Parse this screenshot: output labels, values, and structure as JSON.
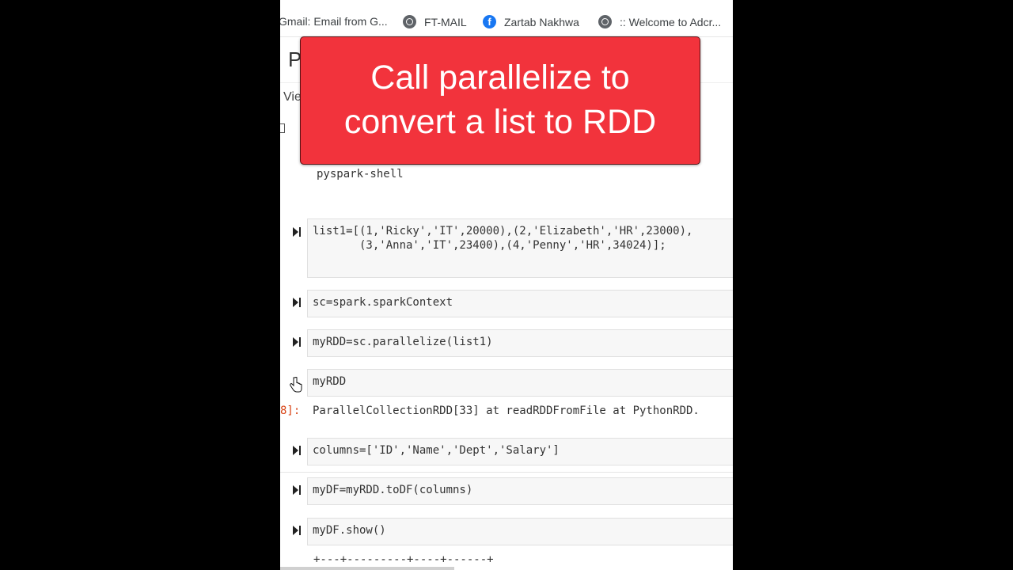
{
  "bookmarks": [
    {
      "label": "Gmail: Email from G...",
      "icon": "gmail-icon"
    },
    {
      "label": "FT-MAIL",
      "icon": "globe-icon"
    },
    {
      "label": "Zartab Nakhwa",
      "icon": "facebook-icon"
    },
    {
      "label": ":: Welcome to Adcr...",
      "icon": "globe-icon"
    }
  ],
  "notebook": {
    "title_fragment": "P",
    "menu_fragment": "Vie"
  },
  "banner": {
    "line1": "Call parallelize to",
    "line2": "convert a list to RDD",
    "color": "#f2333c"
  },
  "cells": {
    "markdown_text": "pyspark-shell",
    "list1_line1": "list1=[(1,'Ricky','IT',20000),(2,'Elizabeth','HR',23000),",
    "list1_line2": "       (3,'Anna','IT',23400),(4,'Penny','HR',34024)];",
    "sc": "sc=spark.sparkContext",
    "parallelize": "myRDD=sc.parallelize(list1)",
    "myrdd": "myRDD",
    "output_prompt": "8]:",
    "output": "ParallelCollectionRDD[33] at readRDDFromFile at PythonRDD.",
    "columns": "columns=['ID','Name','Dept','Salary']",
    "todf": "myDF=myRDD.toDF(columns)",
    "show": "myDF.show()",
    "ascii_border": "+---+---------+----+------+"
  }
}
